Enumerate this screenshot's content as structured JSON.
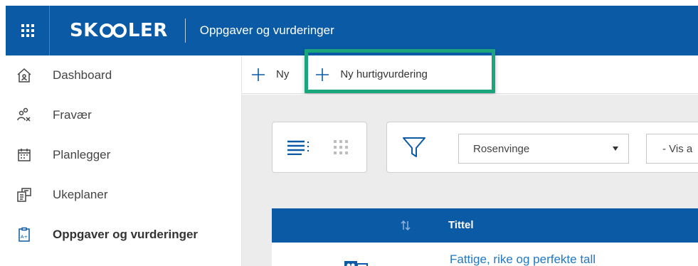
{
  "header": {
    "logo_text_1": "SK",
    "logo_text_2": "LER",
    "title": "Oppgaver og vurderinger"
  },
  "sidebar": {
    "items": [
      {
        "label": "Dashboard",
        "icon": "home-icon"
      },
      {
        "label": "Fravær",
        "icon": "absence-icon"
      },
      {
        "label": "Planlegger",
        "icon": "calendar-icon"
      },
      {
        "label": "Ukeplaner",
        "icon": "weekplan-icon"
      },
      {
        "label": "Oppgaver og vurderinger",
        "icon": "assignment-icon",
        "active": true
      }
    ]
  },
  "toolbar": {
    "new_label": "Ny",
    "quick_label": "Ny hurtigvurdering"
  },
  "filters": {
    "school_value": "Rosenvinge",
    "vis_value": "- Vis a"
  },
  "table": {
    "columns": {
      "title": "Tittel"
    },
    "rows": [
      {
        "title": "Fattige, rike og perfekte tall"
      }
    ]
  },
  "colors": {
    "brand": "#0a5aa6",
    "highlight": "#1aa57d",
    "link": "#2277c4"
  }
}
